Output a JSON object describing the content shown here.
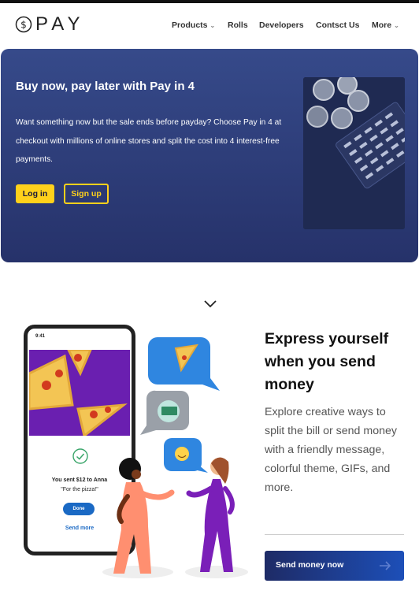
{
  "brand": {
    "logo_text": "PAY"
  },
  "nav": {
    "items": [
      {
        "label": "Products",
        "has_dropdown": true
      },
      {
        "label": "Rolls",
        "has_dropdown": false
      },
      {
        "label": "Developers",
        "has_dropdown": false
      },
      {
        "label": "Contsct Us",
        "has_dropdown": false
      },
      {
        "label": "More",
        "has_dropdown": true
      }
    ]
  },
  "hero": {
    "title": "Buy now, pay later with Pay in 4",
    "description": "Want something now but the sale ends before payday? Choose Pay in 4 at checkout with millions of online stores and split the cost into 4 interest-free payments.",
    "login_label": "Log in",
    "signup_label": "Sign up"
  },
  "feature": {
    "headline": "Express yourself when you send money",
    "body": "Explore creative ways to split the bill or send money with a friendly message, colorful theme, GIFs, and more.",
    "cta_label": "Send money now"
  },
  "phone": {
    "time": "9:41",
    "sent_text": "You sent $12 to Anna",
    "note_text": "\"For the pizza!\"",
    "done_label": "Done",
    "more_label": "Send more"
  },
  "colors": {
    "hero_bg": "#2e3d7a",
    "accent_yellow": "#ffd11b",
    "cta_blue": "#1d4fb8",
    "pizza_purple": "#6a1fb0"
  },
  "icons": [
    "dollar-circle-icon",
    "chevron-down-icon",
    "arrow-right-icon",
    "check-circle-icon",
    "pizza-icon",
    "money-icon",
    "emoji-icon"
  ]
}
